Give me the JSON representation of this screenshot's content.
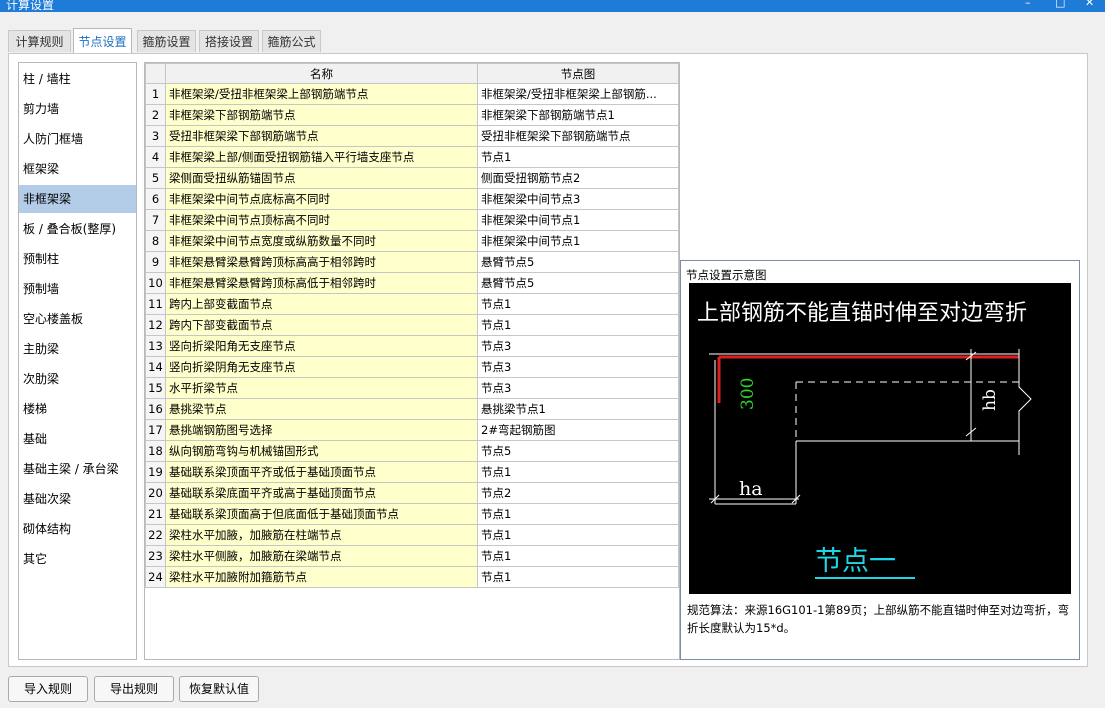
{
  "window": {
    "title": "计算设置",
    "controls": [
      "–",
      "□",
      "✕"
    ]
  },
  "tabs": [
    {
      "label": "计算规则",
      "active": false
    },
    {
      "label": "节点设置",
      "active": true
    },
    {
      "label": "箍筋设置",
      "active": false
    },
    {
      "label": "搭接设置",
      "active": false
    },
    {
      "label": "箍筋公式",
      "active": false
    }
  ],
  "categories": [
    "柱 / 墙柱",
    "剪力墙",
    "人防门框墙",
    "框架梁",
    "非框架梁",
    "板 / 叠合板(整厚)",
    "预制柱",
    "预制墙",
    "空心楼盖板",
    "主肋梁",
    "次肋梁",
    "楼梯",
    "基础",
    "基础主梁 / 承台梁",
    "基础次梁",
    "砌体结构",
    "其它"
  ],
  "selected_category": "非框架梁",
  "table": {
    "headers": [
      "",
      "名称",
      "节点图"
    ],
    "rows": [
      {
        "num": "1",
        "name": "非框架梁/受扭非框架梁上部钢筋端节点",
        "value": "非框架梁/受扭非框架梁上部钢筋..."
      },
      {
        "num": "2",
        "name": "非框架梁下部钢筋端节点",
        "value": "非框架梁下部钢筋端节点1"
      },
      {
        "num": "3",
        "name": "受扭非框架梁下部钢筋端节点",
        "value": "受扭非框架梁下部钢筋端节点"
      },
      {
        "num": "4",
        "name": "非框架梁上部/侧面受扭钢筋锚入平行墙支座节点",
        "value": "节点1"
      },
      {
        "num": "5",
        "name": "梁侧面受扭纵筋锚固节点",
        "value": "侧面受扭钢筋节点2"
      },
      {
        "num": "6",
        "name": "非框架梁中间节点底标高不同时",
        "value": "非框架梁中间节点3"
      },
      {
        "num": "7",
        "name": "非框架梁中间节点顶标高不同时",
        "value": "非框架梁中间节点1"
      },
      {
        "num": "8",
        "name": "非框架梁中间节点宽度或纵筋数量不同时",
        "value": "非框架梁中间节点1"
      },
      {
        "num": "9",
        "name": "非框架悬臂梁悬臂跨顶标高高于相邻跨时",
        "value": "悬臂节点5"
      },
      {
        "num": "10",
        "name": "非框架悬臂梁悬臂跨顶标高低于相邻跨时",
        "value": "悬臂节点5"
      },
      {
        "num": "11",
        "name": "跨内上部变截面节点",
        "value": "节点1"
      },
      {
        "num": "12",
        "name": "跨内下部变截面节点",
        "value": "节点1"
      },
      {
        "num": "13",
        "name": "竖向折梁阳角无支座节点",
        "value": "节点3"
      },
      {
        "num": "14",
        "name": "竖向折梁阴角无支座节点",
        "value": "节点3"
      },
      {
        "num": "15",
        "name": "水平折梁节点",
        "value": "节点3"
      },
      {
        "num": "16",
        "name": "悬挑梁节点",
        "value": "悬挑梁节点1"
      },
      {
        "num": "17",
        "name": "悬挑端钢筋图号选择",
        "value": "2#弯起钢筋图"
      },
      {
        "num": "18",
        "name": "纵向钢筋弯钩与机械锚固形式",
        "value": "节点5"
      },
      {
        "num": "19",
        "name": "基础联系梁顶面平齐或低于基础顶面节点",
        "value": "节点1"
      },
      {
        "num": "20",
        "name": "基础联系梁底面平齐或高于基础顶面节点",
        "value": "节点2"
      },
      {
        "num": "21",
        "name": "基础联系梁顶面高于但底面低于基础顶面节点",
        "value": "节点1"
      },
      {
        "num": "22",
        "name": "梁柱水平加腋，加腋筋在柱端节点",
        "value": "节点1"
      },
      {
        "num": "23",
        "name": "梁柱水平侧腋，加腋筋在梁端节点",
        "value": "节点1"
      },
      {
        "num": "24",
        "name": "梁柱水平加腋附加箍筋节点",
        "value": "节点1"
      }
    ]
  },
  "diagram": {
    "title": "节点设置示意图",
    "heading": "上部钢筋不能直锚时伸至对边弯折",
    "label_300": "300",
    "label_hb": "hb",
    "label_ha": "ha",
    "caption": "节点一",
    "colors": {
      "bg": "#000000",
      "rebar": "#e01e1e",
      "green": "#2ad62a",
      "line": "#ffffff",
      "caption": "#1ed6e6"
    },
    "description": "规范算法：来源16G101-1第89页；上部纵筋不能直锚时伸至对边弯折，弯折长度默认为15*d。"
  },
  "buttons": {
    "import": "导入规则",
    "export": "导出规则",
    "restore": "恢复默认值"
  }
}
